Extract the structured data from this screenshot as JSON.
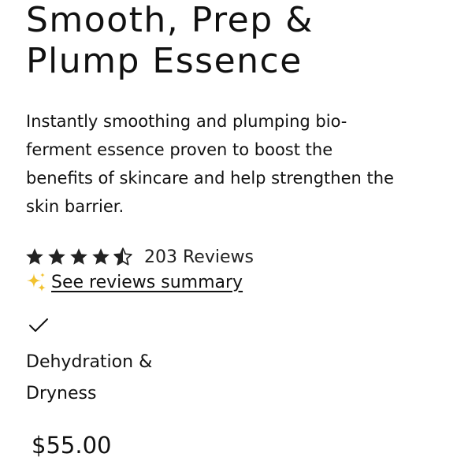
{
  "product": {
    "title_lines": [
      "Smooth, Prep &",
      "Plump Essence"
    ],
    "description_lines": [
      "Instantly smoothing and plumping bio-",
      "ferment essence proven to boost the",
      "benefits of skincare and help strengthen the",
      "skin barrier."
    ],
    "rating": 4.5,
    "rating_max": 5,
    "reviews_label": "203 Reviews",
    "summary_link": "See reviews summary",
    "concern_lines": [
      "Dehydration &",
      "Dryness"
    ],
    "price": "$55.00"
  },
  "icons": {
    "star": "star-icon",
    "half_star": "half-star-icon",
    "sparkle": "sparkle-icon",
    "check": "checkmark-icon"
  },
  "colors": {
    "text": "#111111",
    "star": "#222222",
    "sparkle": "#F2C230"
  }
}
